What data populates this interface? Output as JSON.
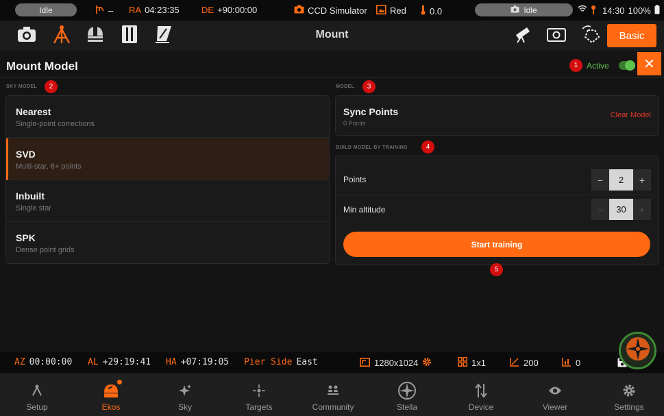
{
  "status_bar": {
    "left_pill": "Idle",
    "mount_value": "–",
    "ra_label": "RA",
    "ra_value": "04:23:35",
    "de_label": "DE",
    "de_value": "+90:00:00",
    "camera": "CCD Simulator",
    "filter": "Red",
    "temperature": "0.0",
    "right_pill": "Idle",
    "time": "14:30",
    "battery": "100%"
  },
  "toolbar": {
    "title": "Mount",
    "basic_label": "Basic"
  },
  "header": {
    "title": "Mount Model",
    "active_label": "Active",
    "close_symbol": "✕"
  },
  "badges": [
    "1",
    "2",
    "3",
    "4",
    "5"
  ],
  "sky_model": {
    "label": "SKY MODEL",
    "items": [
      {
        "name": "Nearest",
        "desc": "Single-point corrections"
      },
      {
        "name": "SVD",
        "desc": "Multi-star, 6+ points"
      },
      {
        "name": "Inbuilt",
        "desc": "Single star"
      },
      {
        "name": "SPK",
        "desc": "Dense point grids"
      }
    ],
    "selected_index": 1
  },
  "model": {
    "label": "MODEL",
    "title": "Sync Points",
    "subtitle": "0 Points",
    "clear_label": "Clear Model"
  },
  "training": {
    "label": "BUILD MODEL BY TRAINING",
    "points_label": "Points",
    "points_value": "2",
    "min_alt_label": "Min altitude",
    "min_alt_value": "30",
    "minus": "−",
    "plus": "+",
    "start_label": "Start training"
  },
  "info_bar": {
    "az_label": "AZ",
    "az_value": "00:00:00",
    "al_label": "AL",
    "al_value": "+29:19:41",
    "ha_label": "HA",
    "ha_value": "+07:19:05",
    "pier_label": "Pier Side",
    "pier_value": "East",
    "resolution": "1280x1024",
    "binning": "1x1",
    "gain": "200",
    "offset": "0"
  },
  "bottom_nav": [
    {
      "label": "Setup"
    },
    {
      "label": "Ekos"
    },
    {
      "label": "Sky"
    },
    {
      "label": "Targets"
    },
    {
      "label": "Community"
    },
    {
      "label": "Stella"
    },
    {
      "label": "Device"
    },
    {
      "label": "Viewer"
    },
    {
      "label": "Settings"
    }
  ],
  "colors": {
    "accent": "#ff6a13",
    "active_green": "#5ec24c",
    "danger_red": "#e23a2a",
    "badge_red": "#d40e0e"
  }
}
